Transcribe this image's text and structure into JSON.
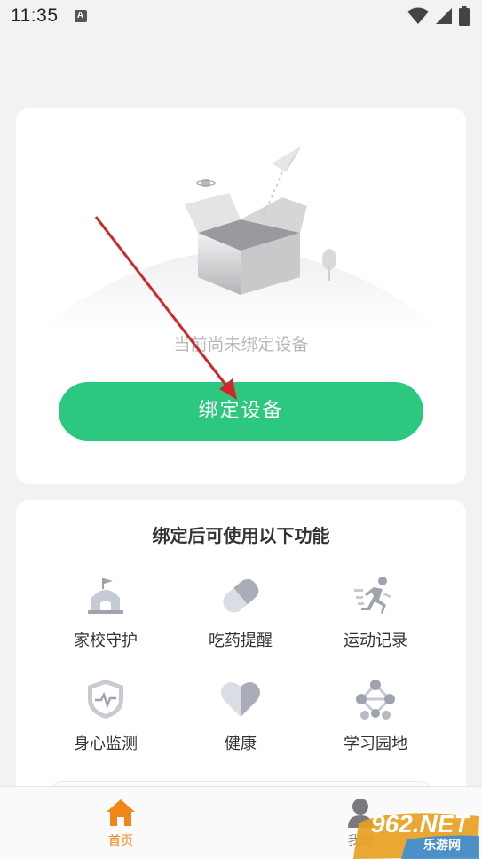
{
  "status_bar": {
    "time": "11:35",
    "notification_icon": "A"
  },
  "empty_state": {
    "message": "当前尚未绑定设备"
  },
  "bind_button": {
    "label": "绑定设备"
  },
  "features": {
    "title": "绑定后可使用以下功能",
    "items": [
      {
        "label": "家校守护",
        "icon": "school-icon"
      },
      {
        "label": "吃药提醒",
        "icon": "pill-icon"
      },
      {
        "label": "运动记录",
        "icon": "running-icon"
      },
      {
        "label": "身心监测",
        "icon": "shield-pulse-icon"
      },
      {
        "label": "健康",
        "icon": "heart-icon"
      },
      {
        "label": "学习园地",
        "icon": "network-icon"
      }
    ]
  },
  "tabbar": {
    "tabs": [
      {
        "label": "首页",
        "icon": "home-icon",
        "active": true
      },
      {
        "label": "我的",
        "icon": "person-icon",
        "active": false
      }
    ],
    "active_color": "#f08519"
  },
  "watermark": {
    "brand": "962.NET",
    "sub": "乐游网"
  },
  "colors": {
    "primary": "#2dc87f",
    "arrow": "#d02828",
    "page_bg": "#f2f2f4"
  }
}
